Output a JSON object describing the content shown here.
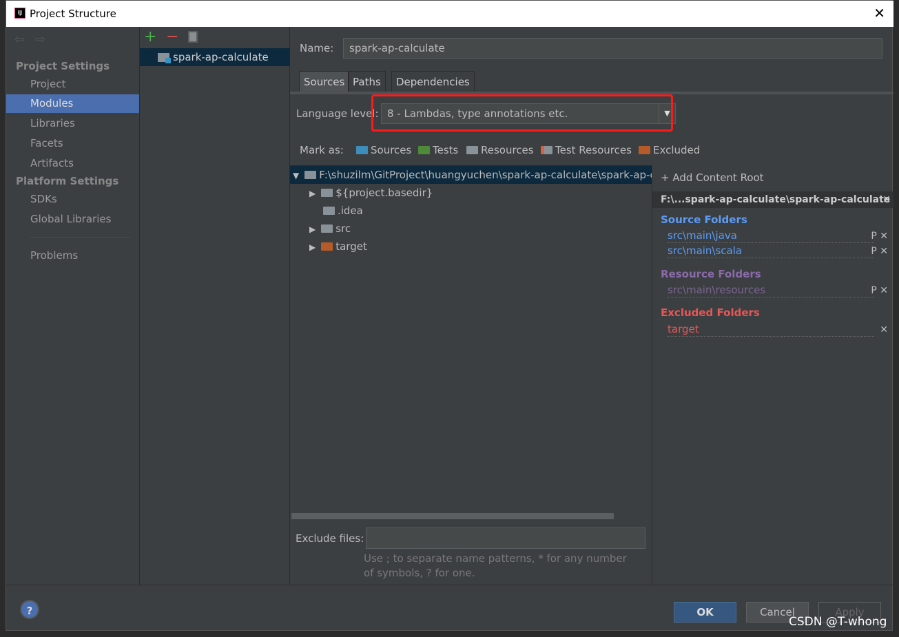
{
  "window": {
    "title": "Project Structure",
    "logo": "IJ"
  },
  "sidebar": {
    "project_settings": "Project Settings",
    "items1": [
      "Project",
      "Modules",
      "Libraries",
      "Facets",
      "Artifacts"
    ],
    "platform_settings": "Platform Settings",
    "items2": [
      "SDKs",
      "Global Libraries"
    ],
    "problems": "Problems",
    "selected": "Modules"
  },
  "modules": {
    "items": [
      "spark-ap-calculate"
    ]
  },
  "main": {
    "name_label": "Name:",
    "name_value": "spark-ap-calculate",
    "tabs": [
      "Sources",
      "Paths",
      "Dependencies"
    ],
    "active_tab": "Sources",
    "language_level_label": "Language level:",
    "language_level_value": "8 - Lambdas, type annotations etc.",
    "mark_as_label": "Mark as:",
    "mark_as": [
      "Sources",
      "Tests",
      "Resources",
      "Test Resources",
      "Excluded"
    ],
    "tree": {
      "root": "F:\\shuzilm\\GitProject\\huangyuchen\\spark-ap-calculate\\spark-ap-c",
      "children": [
        "${project.basedir}",
        ".idea",
        "src",
        "target"
      ]
    },
    "exclude_label": "Exclude files:",
    "exclude_value": "",
    "exclude_hint": "Use ; to separate name patterns, * for any number of symbols, ? for one."
  },
  "roots": {
    "add": "Add Content Root",
    "path": "F:\\...spark-ap-calculate\\spark-ap-calculate",
    "source_title": "Source Folders",
    "sources": [
      "src\\main\\java",
      "src\\main\\scala"
    ],
    "resource_title": "Resource Folders",
    "resources": [
      "src\\main\\resources"
    ],
    "excluded_title": "Excluded Folders",
    "excluded": [
      "target"
    ]
  },
  "buttons": {
    "ok": "OK",
    "cancel": "Cancel",
    "apply": "Apply",
    "help": "?"
  },
  "watermark": "CSDN @T-whong",
  "colors": {
    "source": "#5c9cf5",
    "resource": "#8a6aa8",
    "excluded": "#e85656",
    "highlight": "#ff0000",
    "selection": "#4b6eaf"
  }
}
